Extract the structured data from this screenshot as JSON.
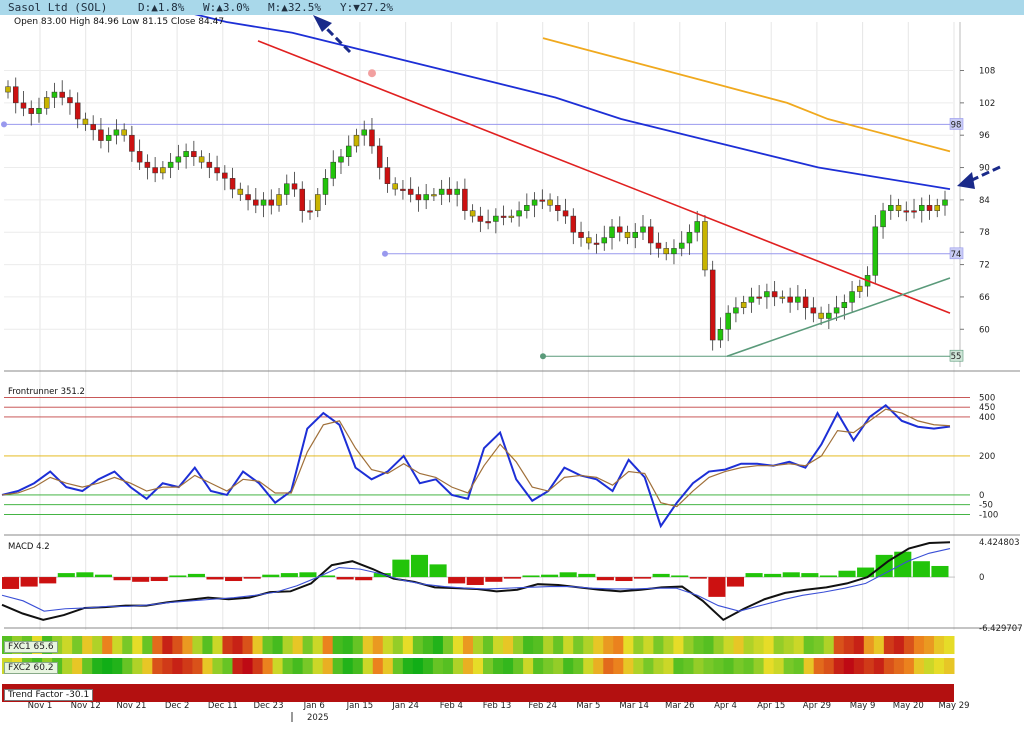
{
  "header": {
    "symbol": "Sasol Ltd (SOL)",
    "d_label": "D:",
    "d_dir": "▲",
    "d_value": "1.8%",
    "w_label": "W:",
    "w_dir": "▲",
    "w_value": "3.0%",
    "m_label": "M:",
    "m_dir": "▲",
    "m_value": "32.5%",
    "y_label": "Y:",
    "y_dir": "▼",
    "y_value": "27.2%"
  },
  "ohlc_line": "Open 83.00  High 84.96  Low 81.15  Close 84.47",
  "colors": {
    "header_bg": "#a9d8ea",
    "up": "#22c40a",
    "down": "#cc1111",
    "neutral": "#c8b400",
    "ma_short": "#1d2fd6",
    "ma_long": "#f0a91e",
    "trend_down": "#e02020",
    "trend_up": "#5a9a7a",
    "frontrunner": "#1d2fd6",
    "signal": "#a0703a",
    "macd_line": "#111111",
    "macd_signal": "#3a4fd6"
  },
  "chart_data": [
    {
      "type": "candlestick",
      "price_axis_ticks": [
        108,
        102,
        96,
        90,
        84,
        78,
        72,
        66,
        60
      ],
      "ylim": [
        53,
        117
      ],
      "marked_levels": [
        {
          "value": 98,
          "label": "98"
        },
        {
          "value": 74,
          "label": "74"
        },
        {
          "value": 55,
          "label": "55"
        }
      ],
      "x_tick_labels": [
        "Nov 1",
        "Nov 12",
        "Nov 21",
        "Dec 2",
        "Dec 11",
        "Dec 23",
        "Jan 6",
        "Jan 15",
        "Jan 24",
        "Feb 4",
        "Feb 13",
        "Feb 24",
        "Mar 5",
        "Mar 14",
        "Mar 26",
        "Apr 4",
        "Apr 15",
        "Apr 29",
        "May 9",
        "May 20",
        "May 29"
      ],
      "year_label": "2025",
      "closes": [
        105,
        102,
        101,
        100,
        101,
        103,
        104,
        103,
        102,
        99,
        98,
        97,
        95,
        96,
        97,
        96,
        93,
        91,
        90,
        89,
        90,
        91,
        92,
        93,
        92,
        91,
        90,
        89,
        88,
        86,
        85,
        84,
        83,
        84,
        83,
        85,
        87,
        86,
        82,
        82,
        85,
        88,
        91,
        92,
        94,
        96,
        97,
        94,
        90,
        87,
        86,
        86,
        85,
        84,
        85,
        85,
        86,
        85,
        86,
        82,
        81,
        80,
        80,
        81,
        81,
        81,
        82,
        83,
        84,
        84,
        83,
        82,
        81,
        78,
        77,
        76,
        76,
        77,
        79,
        78,
        77,
        78,
        79,
        76,
        75,
        74,
        75,
        76,
        78,
        80,
        71,
        58,
        60,
        63,
        64,
        65,
        66,
        66,
        67,
        66,
        66,
        65,
        66,
        64,
        63,
        62,
        63,
        64,
        65,
        67,
        68,
        70,
        79,
        82,
        83,
        82,
        82,
        82,
        83,
        82,
        83,
        84
      ],
      "series": [
        {
          "name": "",
          "kind": "ma_short",
          "values": [
            122,
            120,
            117,
            115,
            112,
            109,
            106,
            103,
            99,
            96,
            93,
            90,
            88,
            86
          ]
        },
        {
          "name": "",
          "kind": "ma_long",
          "values": [
            114,
            112,
            110,
            108,
            106,
            104,
            102,
            99,
            97,
            95,
            93
          ]
        }
      ],
      "trendlines": [
        "down",
        "up"
      ]
    },
    {
      "type": "line",
      "title": "Frontrunner 351.2",
      "levels": [
        500,
        450,
        400,
        200,
        0,
        -50,
        -100
      ],
      "level_labels": [
        "500",
        "450",
        "400",
        "200",
        "0",
        "-50",
        "-100"
      ],
      "ylim": [
        -180,
        600
      ],
      "series": [
        {
          "name": "",
          "values": [
            0,
            20,
            60,
            120,
            40,
            20,
            80,
            120,
            40,
            -20,
            60,
            40,
            140,
            20,
            0,
            120,
            60,
            -40,
            20,
            340,
            420,
            360,
            140,
            80,
            120,
            200,
            60,
            80,
            0,
            -20,
            240,
            320,
            80,
            -30,
            20,
            140,
            100,
            80,
            20,
            180,
            90,
            -160,
            -40,
            60,
            120,
            130,
            160,
            160,
            150,
            170,
            140,
            260,
            420,
            280,
            400,
            460,
            380,
            350,
            340,
            351
          ]
        },
        {
          "name": "",
          "values": [
            0,
            10,
            40,
            90,
            60,
            40,
            60,
            90,
            60,
            20,
            40,
            40,
            100,
            60,
            20,
            80,
            70,
            10,
            10,
            220,
            360,
            380,
            240,
            130,
            110,
            160,
            110,
            90,
            40,
            10,
            150,
            260,
            170,
            40,
            20,
            90,
            100,
            90,
            50,
            120,
            110,
            -40,
            -60,
            20,
            90,
            120,
            140,
            150,
            150,
            160,
            150,
            200,
            330,
            320,
            380,
            440,
            420,
            380,
            360,
            355
          ]
        }
      ]
    },
    {
      "type": "bar",
      "title": "MACD 4.2",
      "axis_labels": [
        "4.424803",
        "0",
        "-6.429707"
      ],
      "ylim": [
        -6.429707,
        4.424803
      ],
      "histogram": [
        -1.5,
        -1.2,
        -0.8,
        0.5,
        0.6,
        0.3,
        -0.4,
        -0.6,
        -0.5,
        0.2,
        0.4,
        -0.3,
        -0.5,
        -0.2,
        0.3,
        0.5,
        0.6,
        0.2,
        -0.3,
        -0.4,
        0.5,
        2.2,
        2.8,
        1.6,
        -0.8,
        -1.0,
        -0.6,
        -0.2,
        0.2,
        0.3,
        0.6,
        0.4,
        -0.4,
        -0.5,
        -0.2,
        0.4,
        0.2,
        -0.2,
        -2.5,
        -1.2,
        0.5,
        0.4,
        0.6,
        0.5,
        0.2,
        0.8,
        1.2,
        2.8,
        3.2,
        2.0,
        1.4
      ],
      "series": [
        {
          "name": "",
          "values": [
            -3.5,
            -4.6,
            -5.4,
            -4.8,
            -3.9,
            -3.8,
            -3.6,
            -3.6,
            -3.2,
            -2.9,
            -2.6,
            -2.8,
            -2.6,
            -1.9,
            -1.8,
            -0.8,
            1.5,
            2.0,
            1.0,
            -0.2,
            -0.6,
            -1.3,
            -1.4,
            -1.5,
            -1.8,
            -1.6,
            -0.9,
            -1.0,
            -1.3,
            -1.6,
            -1.8,
            -1.6,
            -1.3,
            -1.2,
            -3.0,
            -5.4,
            -4.0,
            -2.8,
            -2.0,
            -1.6,
            -1.3,
            -0.8,
            0.0,
            2.0,
            3.6,
            4.3,
            4.4
          ]
        },
        {
          "name": "",
          "values": [
            -2.3,
            -3.0,
            -4.3,
            -4.0,
            -3.9,
            -3.7,
            -3.7,
            -3.5,
            -3.2,
            -3.0,
            -2.8,
            -2.6,
            -2.3,
            -1.9,
            -1.1,
            0.0,
            1.2,
            1.0,
            0.4,
            -0.4,
            -0.9,
            -1.2,
            -1.4,
            -1.5,
            -1.4,
            -1.3,
            -1.2,
            -1.2,
            -1.4,
            -1.5,
            -1.5,
            -1.4,
            -1.4,
            -2.3,
            -3.6,
            -4.3,
            -3.6,
            -2.9,
            -2.3,
            -1.9,
            -1.4,
            -0.8,
            0.6,
            2.0,
            3.0,
            3.6
          ]
        }
      ]
    },
    {
      "type": "heatmap",
      "title": "FXC1 65.6",
      "values": [
        0.25,
        0.4,
        0.3,
        0.55,
        0.2,
        0.4,
        0.5,
        0.35,
        0.6,
        0.45,
        0.75,
        0.5,
        0.35,
        0.55,
        0.3,
        0.8,
        0.95,
        0.85,
        0.7,
        0.45,
        0.25,
        0.5,
        0.9,
        0.95,
        0.85,
        0.6,
        0.3,
        0.2,
        0.45,
        0.6,
        0.35,
        0.5,
        0.75,
        0.2,
        0.15,
        0.3,
        0.6,
        0.7,
        0.5,
        0.4,
        0.55,
        0.3,
        0.2,
        0.1,
        0.35,
        0.55,
        0.7,
        0.45,
        0.3,
        0.5,
        0.6,
        0.4,
        0.2,
        0.25,
        0.45,
        0.3,
        0.5,
        0.35,
        0.45,
        0.6,
        0.7,
        0.75,
        0.55,
        0.4,
        0.5,
        0.35,
        0.45,
        0.55,
        0.4,
        0.3,
        0.25,
        0.4,
        0.5,
        0.6,
        0.45,
        0.5,
        0.55,
        0.4,
        0.45,
        0.5,
        0.3,
        0.35,
        0.45,
        0.85,
        0.9,
        0.95,
        0.7,
        0.6,
        0.9,
        0.95,
        0.85,
        0.75,
        0.7,
        0.6,
        0.55
      ]
    },
    {
      "type": "heatmap",
      "title": "FXC2 60.2",
      "values": [
        0.5,
        0.55,
        0.3,
        0.2,
        0.4,
        0.25,
        0.45,
        0.6,
        0.3,
        0.1,
        0.05,
        0.1,
        0.3,
        0.45,
        0.6,
        0.85,
        0.9,
        0.95,
        0.9,
        0.85,
        0.6,
        0.4,
        0.3,
        0.95,
        1.0,
        0.9,
        0.75,
        0.5,
        0.3,
        0.2,
        0.35,
        0.5,
        0.65,
        0.25,
        0.1,
        0.2,
        0.5,
        0.75,
        0.6,
        0.3,
        0.1,
        0.05,
        0.15,
        0.3,
        0.25,
        0.45,
        0.65,
        0.55,
        0.35,
        0.2,
        0.15,
        0.3,
        0.5,
        0.25,
        0.35,
        0.4,
        0.2,
        0.3,
        0.5,
        0.65,
        0.8,
        0.75,
        0.6,
        0.45,
        0.35,
        0.45,
        0.5,
        0.25,
        0.3,
        0.4,
        0.35,
        0.3,
        0.25,
        0.35,
        0.3,
        0.4,
        0.55,
        0.5,
        0.35,
        0.3,
        0.6,
        0.8,
        0.85,
        0.95,
        1.0,
        0.95,
        0.9,
        0.95,
        0.85,
        0.8,
        0.75,
        0.6,
        0.5,
        0.55,
        0.6
      ]
    },
    {
      "type": "heatmap",
      "title": "Trend Factor -30.1",
      "values": [
        0.95
      ]
    }
  ]
}
